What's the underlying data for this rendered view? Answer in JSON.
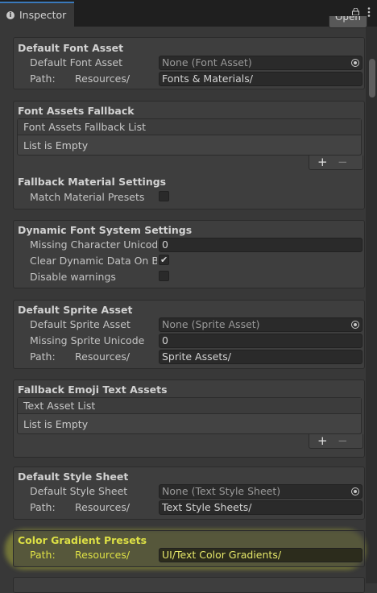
{
  "window": {
    "tab_label": "Inspector",
    "open_label": "Open"
  },
  "sections": {
    "default_font": {
      "title": "Default Font Asset",
      "asset_label": "Default Font Asset",
      "asset_value": "None (Font Asset)",
      "path_label": "Path:",
      "path_prefix": "Resources/",
      "path_value": "Fonts & Materials/"
    },
    "fallback": {
      "title": "Font Assets Fallback",
      "list_header": "Font Assets Fallback List",
      "list_empty": "List is Empty",
      "material_title": "Fallback Material Settings",
      "match_label": "Match Material Presets",
      "match_checked": false
    },
    "dynamic": {
      "title": "Dynamic Font System Settings",
      "missing_label": "Missing Character Unicode",
      "missing_value": "0",
      "clear_label": "Clear Dynamic Data On Build",
      "clear_checked": true,
      "disable_label": "Disable warnings",
      "disable_checked": false
    },
    "sprite": {
      "title": "Default Sprite Asset",
      "asset_label": "Default Sprite Asset",
      "asset_value": "None (Sprite Asset)",
      "missing_label": "Missing Sprite Unicode",
      "missing_value": "0",
      "path_label": "Path:",
      "path_prefix": "Resources/",
      "path_value": "Sprite Assets/"
    },
    "emoji": {
      "title": "Fallback Emoji Text Assets",
      "list_header": "Text Asset List",
      "list_empty": "List is Empty"
    },
    "style": {
      "title": "Default Style Sheet",
      "asset_label": "Default Style Sheet",
      "asset_value": "None (Text Style Sheet)",
      "path_label": "Path:",
      "path_prefix": "Resources/",
      "path_value": "Text Style Sheets/"
    },
    "gradient": {
      "title": "Color Gradient Presets",
      "path_label": "Path:",
      "path_prefix": "Resources/",
      "path_value": "UI/Text Color Gradients/"
    }
  },
  "list_buttons": {
    "add": "+",
    "remove": "−"
  },
  "colors": {
    "highlight": "#e8ec3c",
    "accent": "#3a79bb"
  }
}
